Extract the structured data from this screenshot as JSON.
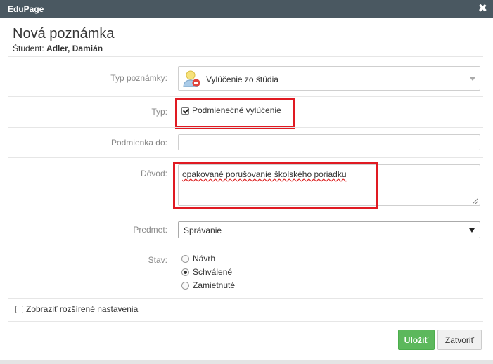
{
  "window": {
    "title": "EduPage",
    "close_glyph": "✖"
  },
  "header": {
    "title": "Nová poznámka",
    "student_label": "Študent:",
    "student_name": "Adler, Damián"
  },
  "form": {
    "note_type": {
      "label": "Typ poznámky:",
      "value": "Vylúčenie zo štúdia",
      "icon": "user-remove-icon"
    },
    "type": {
      "label": "Typ:",
      "checkbox_label": "Podmienečné vylúčenie",
      "checked": true
    },
    "condition_until": {
      "label": "Podmienka do:",
      "value": ""
    },
    "reason": {
      "label": "Dôvod:",
      "value": "opakované porušovanie školského poriadku"
    },
    "subject": {
      "label": "Predmet:",
      "value": "Správanie"
    },
    "status": {
      "label": "Stav:",
      "options": [
        {
          "label": "Návrh",
          "checked": false
        },
        {
          "label": "Schválené",
          "checked": true
        },
        {
          "label": "Zamietnuté",
          "checked": false
        }
      ]
    },
    "advanced": {
      "label": "Zobraziť rozšírené nastavenia",
      "checked": false
    }
  },
  "buttons": {
    "save": "Uložiť",
    "close": "Zatvoriť"
  },
  "colors": {
    "titlebar": "#4a5861",
    "save": "#5cb85c",
    "highlight": "#e01a22"
  }
}
